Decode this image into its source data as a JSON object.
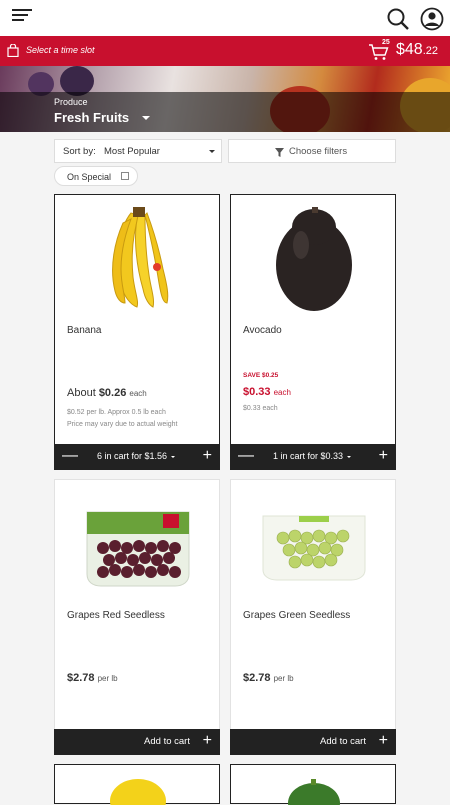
{
  "header": {
    "menu_icon": "hamburger-icon",
    "search_icon": "search-icon",
    "account_icon": "account-icon"
  },
  "timebar": {
    "slot_label": "Select a time slot",
    "cart_count": "25",
    "cart_total_dollars": "$48",
    "cart_total_cents": ".22",
    "accent": "#c8102e"
  },
  "hero": {
    "breadcrumb": "Produce",
    "category": "Fresh Fruits"
  },
  "toolbar": {
    "sort_label": "Sort by:",
    "sort_value": "Most Popular",
    "filter_label": "Choose filters",
    "special_label": "On Special"
  },
  "products": [
    {
      "name": "Banana",
      "price_prefix": "About",
      "price": "$0.26",
      "unit": "each",
      "sub1": "$0.52 per lb. Approx 0.5 lb each",
      "sub2": "Price may vary due to actual weight",
      "cart_label": "6 in cart for $1.56"
    },
    {
      "name": "Avocado",
      "save": "SAVE $0.25",
      "price": "$0.33",
      "unit": "each",
      "sub1": "$0.33 each",
      "cart_label": "1 in cart for $0.33"
    },
    {
      "name": "Grapes Red Seedless",
      "price": "$2.78",
      "unit": "per lb",
      "add_label": "Add to cart"
    },
    {
      "name": "Grapes Green Seedless",
      "price": "$2.78",
      "unit": "per lb",
      "add_label": "Add to cart"
    }
  ],
  "bar_glyphs": {
    "minus": "—",
    "plus": "+"
  }
}
